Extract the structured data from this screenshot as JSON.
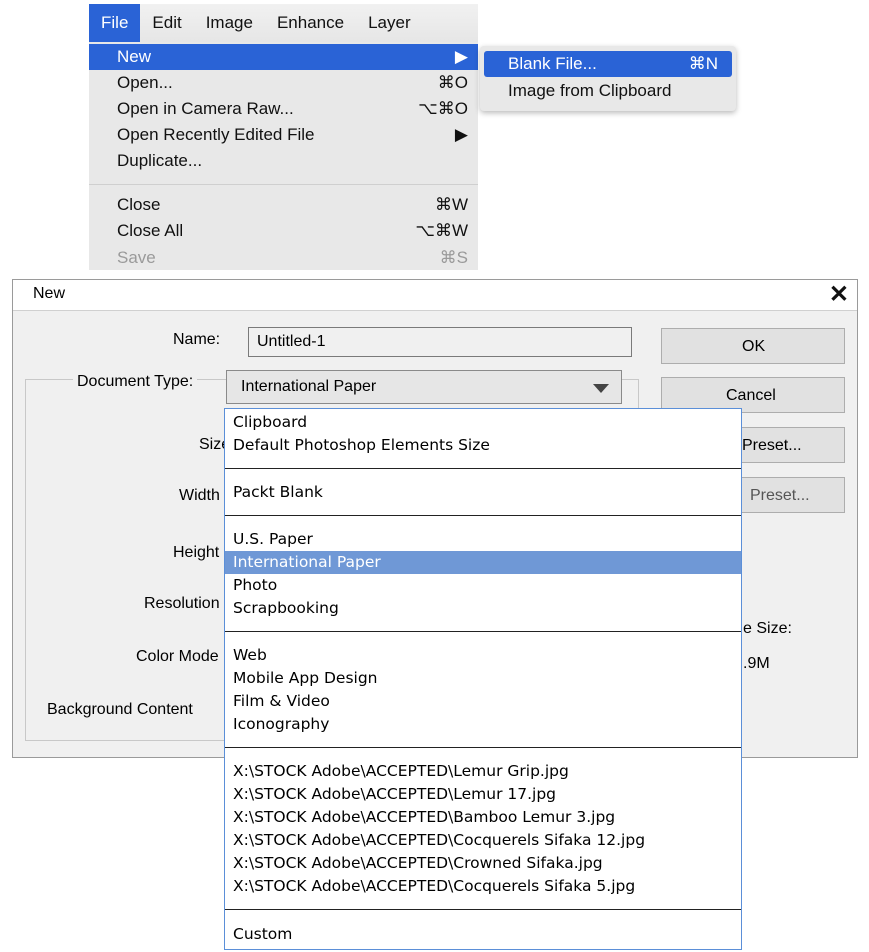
{
  "menubar": {
    "items": [
      "File",
      "Edit",
      "Image",
      "Enhance",
      "Layer"
    ]
  },
  "file_menu": {
    "items": [
      {
        "label": "New",
        "shortcut": "▶"
      },
      {
        "label": "Open...",
        "shortcut": "⌘O"
      },
      {
        "label": "Open in Camera Raw...",
        "shortcut": "⌥⌘O"
      },
      {
        "label": "Open Recently Edited File",
        "shortcut": "▶"
      },
      {
        "label": "Duplicate...",
        "shortcut": ""
      },
      {
        "label": "Close",
        "shortcut": "⌘W"
      },
      {
        "label": "Close All",
        "shortcut": "⌥⌘W"
      },
      {
        "label": "Save",
        "shortcut": "⌘S"
      }
    ]
  },
  "submenu": {
    "items": [
      {
        "label": "Blank File...",
        "shortcut": "⌘N"
      },
      {
        "label": "Image from Clipboard",
        "shortcut": ""
      }
    ]
  },
  "dialog": {
    "title": "New",
    "close_glyph": "✕",
    "name_label": "Name:",
    "name_value": "Untitled-1",
    "doc_type_label": "Document Type:",
    "doc_type_value": "International Paper",
    "field_labels": {
      "size": "Size",
      "width": "Width",
      "height": "Height",
      "resolution": "Resolution",
      "color_mode": "Color Mode",
      "background": "Background Content"
    },
    "buttons": {
      "ok": "OK",
      "cancel": "Cancel",
      "save_preset": "Preset...",
      "delete_preset": "Preset..."
    },
    "image_size_label": "e Size:",
    "image_size_value": ".9M"
  },
  "dropdown": {
    "groups": [
      [
        "Clipboard",
        "Default Photoshop Elements Size"
      ],
      [
        "Packt Blank"
      ],
      [
        "U.S. Paper",
        "International Paper",
        "Photo",
        "Scrapbooking"
      ],
      [
        "Web",
        "Mobile App Design",
        "Film & Video",
        "Iconography"
      ],
      [
        "X:\\STOCK Adobe\\ACCEPTED\\Lemur Grip.jpg",
        "X:\\STOCK Adobe\\ACCEPTED\\Lemur 17.jpg",
        "X:\\STOCK Adobe\\ACCEPTED\\Bamboo Lemur 3.jpg",
        "X:\\STOCK Adobe\\ACCEPTED\\Cocquerels Sifaka 12.jpg",
        "X:\\STOCK Adobe\\ACCEPTED\\Crowned Sifaka.jpg",
        "X:\\STOCK Adobe\\ACCEPTED\\Cocquerels Sifaka 5.jpg"
      ],
      [
        "Custom"
      ]
    ],
    "selected": "International Paper"
  },
  "colors": {
    "mac_highlight": "#2a63d6",
    "list_highlight": "#6f98d6",
    "dialog_bg": "#f0f0f0"
  }
}
